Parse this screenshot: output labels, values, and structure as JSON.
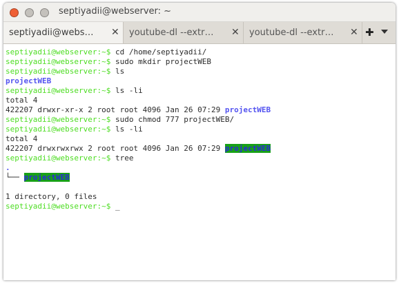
{
  "window": {
    "title": "septiyadii@webserver: ~"
  },
  "tabs": [
    {
      "label": "septiyadii@webs…",
      "active": true
    },
    {
      "label": "youtube-dl --extr…",
      "active": false
    },
    {
      "label": "youtube-dl --extr…",
      "active": false
    }
  ],
  "tab_close_glyph": "✕",
  "new_tab_glyph": "✚",
  "terminal": {
    "prompt": "septiyadii@webserver:~$",
    "lines": [
      {
        "prompt": "septiyadii@webserver:~$",
        "text": " cd /home/septiyadii/"
      },
      {
        "prompt": "septiyadii@webserver:~$",
        "text": " sudo mkdir projectWEB"
      },
      {
        "prompt": "septiyadii@webserver:~$",
        "text": " ls"
      },
      {
        "dir": "projectWEB"
      },
      {
        "prompt": "septiyadii@webserver:~$",
        "text": " ls -li"
      },
      {
        "text": "total 4"
      },
      {
        "text": "422207 drwxr-xr-x 2 root root 4096 Jan 26 07:29 ",
        "dir": "projectWEB"
      },
      {
        "prompt": "septiyadii@webserver:~$",
        "text": " sudo chmod 777 projectWEB/"
      },
      {
        "prompt": "septiyadii@webserver:~$",
        "text": " ls -li"
      },
      {
        "text": "total 4"
      },
      {
        "text": "422207 drwxrwxrwx 2 root root 4096 Jan 26 07:29 ",
        "dir_hl": "projectWEB"
      },
      {
        "prompt": "septiyadii@webserver:~$",
        "text": " tree"
      },
      {
        "dir": "."
      },
      {
        "text": "└── ",
        "dir_hl": "projectWEB"
      },
      {
        "text": ""
      },
      {
        "text": "1 directory, 0 files"
      },
      {
        "prompt": "septiyadii@webserver:~$",
        "text": " ",
        "cursor": "_"
      }
    ]
  },
  "colors": {
    "prompt": "#4ddd22",
    "directory": "#5454f0",
    "highlight_bg": "#18a018",
    "close_button": "#ef5f35"
  }
}
